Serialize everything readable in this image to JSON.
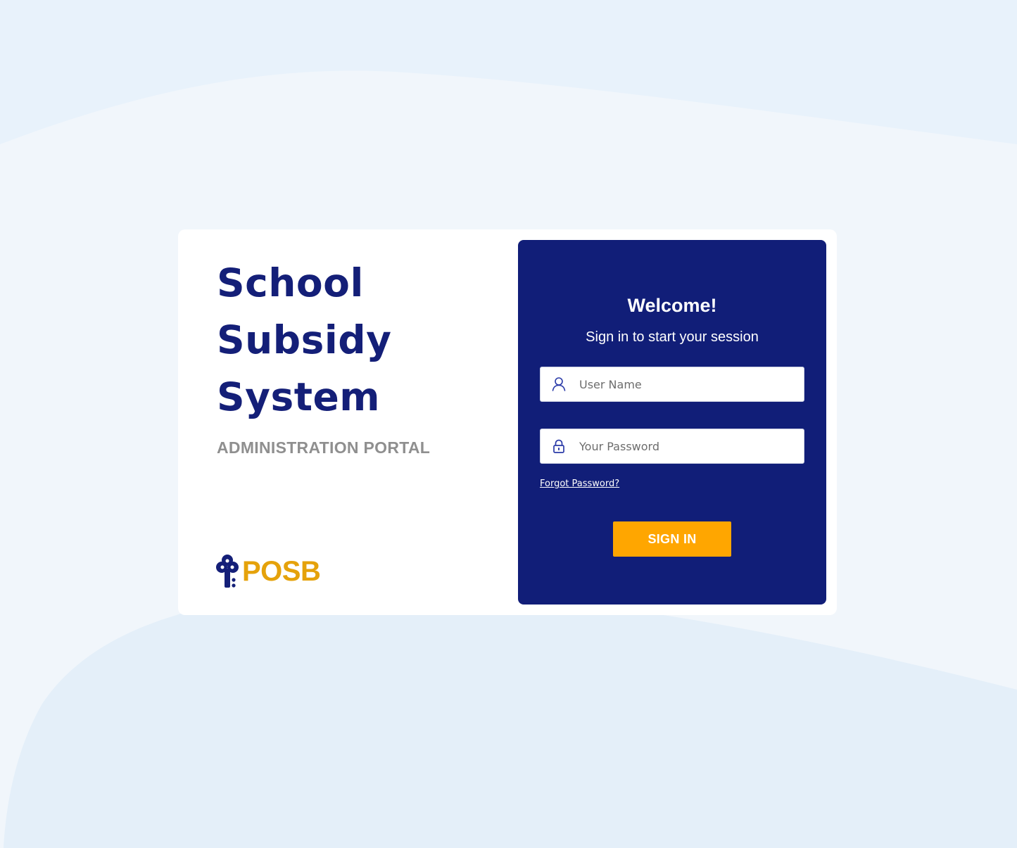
{
  "brand": {
    "title_lines": [
      "School",
      "Subsidy",
      "System"
    ],
    "subtitle": "ADMINISTRATION PORTAL",
    "logo_text": "POSB"
  },
  "login": {
    "welcome": "Welcome!",
    "session_text": "Sign in to start your session",
    "username": {
      "placeholder": "User Name",
      "value": "",
      "icon": "user-icon"
    },
    "password": {
      "placeholder": "Your Password",
      "value": "",
      "icon": "lock-icon"
    },
    "forgot_password": "Forgot Password?",
    "sign_in_label": "SIGN IN"
  },
  "colors": {
    "brand_navy": "#111e78",
    "title_navy": "#141f78",
    "accent_orange": "#ffa600",
    "logo_gold": "#e5a20b",
    "subtitle_gray": "#8f8f8f",
    "background": "#e8f2fb"
  }
}
